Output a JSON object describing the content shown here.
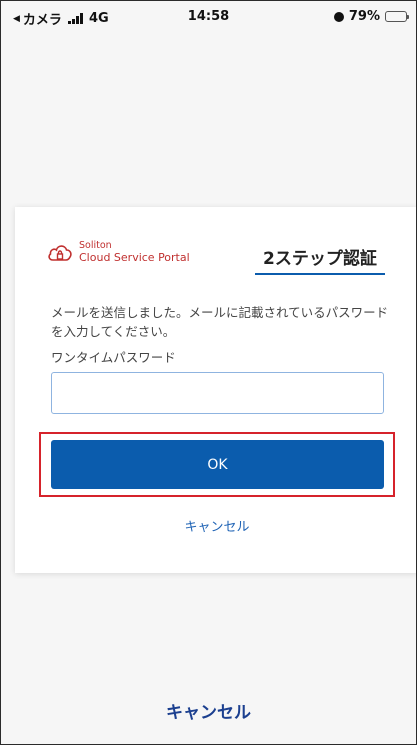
{
  "status_bar": {
    "back_arrow": "◀",
    "carrier": "カメラ",
    "network": "4G",
    "time": "14:58",
    "battery": "79%",
    "battery_level": 0.79,
    "battery_color": "#f5c400"
  },
  "brand": {
    "name_line1": "Soliton",
    "name_line2": "Cloud Service Portal",
    "color": "#c0302f",
    "icon": "cloud-lock-logo"
  },
  "dialog": {
    "title": "2ステップ認証",
    "message": "メールを送信しました。メールに記載されているパスワードを入力してください。",
    "otp_label": "ワンタイムパスワード",
    "otp_value": "",
    "ok_label": "OK",
    "cancel_label": "キャンセル",
    "accent_color": "#0b5cad"
  },
  "footer": {
    "cancel_label": "キャンセル"
  }
}
